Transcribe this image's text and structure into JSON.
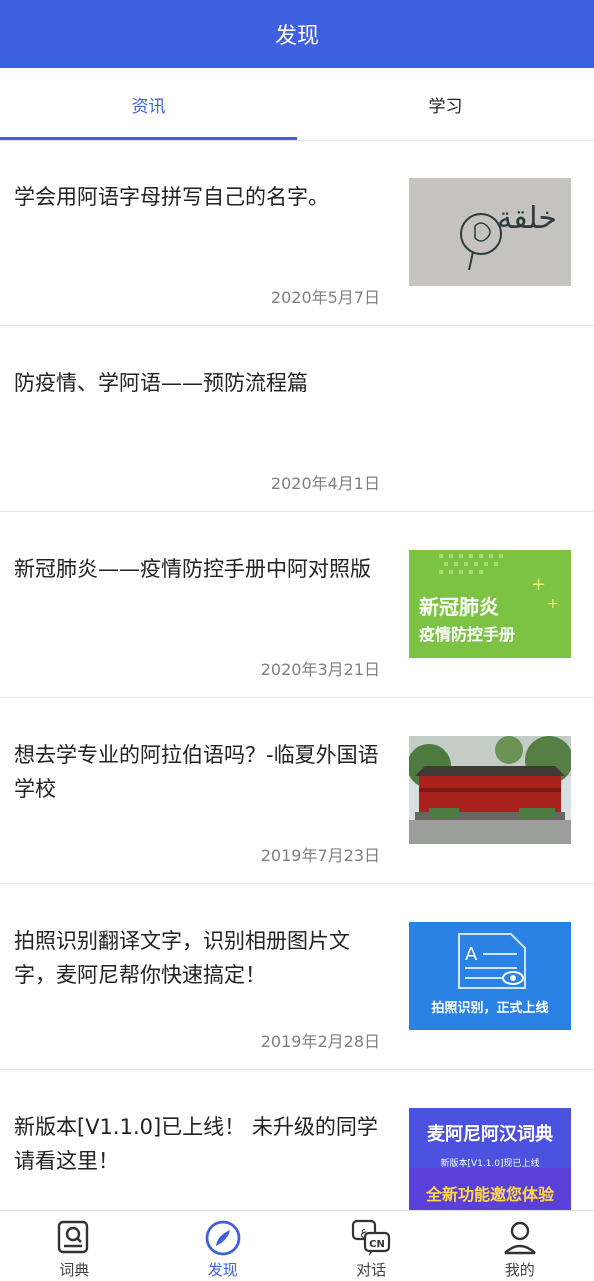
{
  "header": {
    "title": "发现"
  },
  "tabs": [
    {
      "label": "资讯",
      "active": true
    },
    {
      "label": "学习",
      "active": false
    }
  ],
  "articles": [
    {
      "title": "学会用阿语字母拼写自己的名字。",
      "date": "2020年5月7日",
      "thumb_text": "خلقة"
    },
    {
      "title": "防疫情、学阿语——预防流程篇",
      "date": "2020年4月1日"
    },
    {
      "title": "新冠肺炎——疫情防控手册中阿对照版",
      "date": "2020年3月21日",
      "thumb_line1": "新冠肺炎",
      "thumb_line2": "疫情防控手册"
    },
    {
      "title": "想去学专业的阿拉伯语吗？-临夏外国语学校",
      "date": "2019年7月23日"
    },
    {
      "title": "拍照识别翻译文字，识别相册图片文字，麦阿尼帮你快速搞定！",
      "date": "2019年2月28日",
      "thumb_text": "拍照识别，正式上线"
    },
    {
      "title": "新版本[V1.1.0]已上线！ 未升级的同学请看这里！",
      "date": "",
      "thumb_line1": "麦阿尼阿汉词典",
      "thumb_line2": "新版本[V1.1.0]现已上线",
      "thumb_line3": "全新功能邀您体验"
    }
  ],
  "bottom_nav": [
    {
      "label": "词典",
      "icon": "dictionary-icon",
      "active": false
    },
    {
      "label": "发现",
      "icon": "compass-icon",
      "active": true
    },
    {
      "label": "对话",
      "icon": "dialogue-icon",
      "active": false,
      "badge": "CN"
    },
    {
      "label": "我的",
      "icon": "profile-icon",
      "active": false
    }
  ],
  "colors": {
    "brand": "#3d5fe0",
    "date_gray": "#808080",
    "divider": "#e6e6e6",
    "green_thumb": "#7dc343"
  }
}
